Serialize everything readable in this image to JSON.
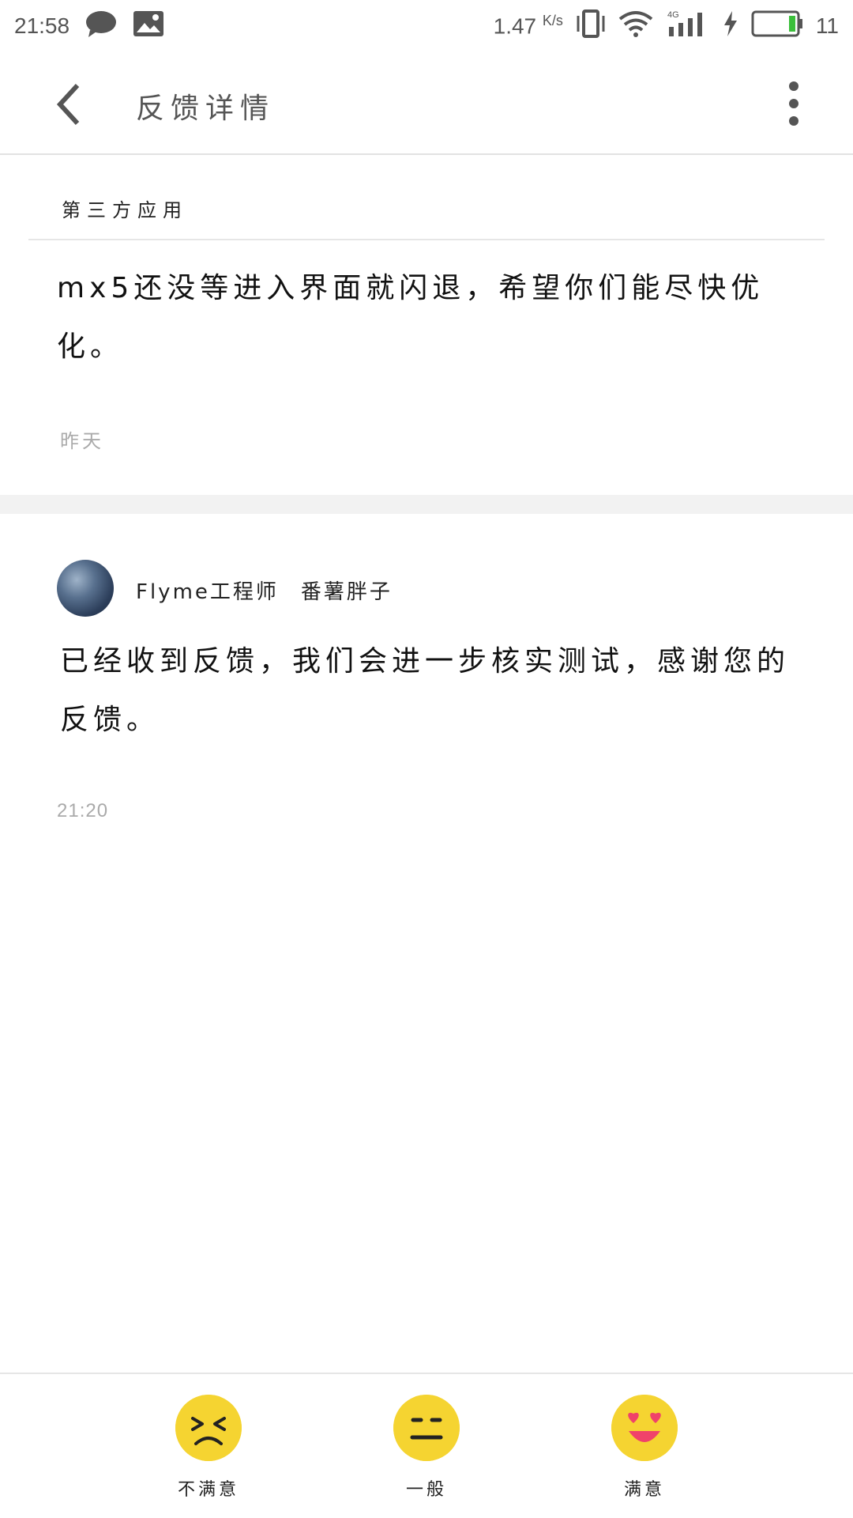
{
  "status_bar": {
    "time": "21:58",
    "network_speed": "1.47",
    "network_speed_unit": "K/s",
    "battery_level": "11",
    "icons": [
      "message-icon",
      "image-icon",
      "vibrate-icon",
      "wifi-icon",
      "signal-4g-icon",
      "charging-icon",
      "battery-icon"
    ]
  },
  "app_bar": {
    "title": "反馈详情",
    "back_icon": "chevron-left-icon",
    "more_icon": "more-vertical-icon"
  },
  "feedback": {
    "category": "第三方应用",
    "message": "mx5还没等进入界面就闪退，希望你们能尽快优化。",
    "time": "昨天"
  },
  "reply": {
    "role": "Flyme工程师",
    "name": "番薯胖子",
    "message": "已经收到反馈，我们会进一步核实测试，感谢您的反馈。",
    "time": "21:20"
  },
  "rating": {
    "options": [
      {
        "label": "不满意",
        "icon": "unsatisfied-face-icon"
      },
      {
        "label": "一般",
        "icon": "neutral-face-icon"
      },
      {
        "label": "满意",
        "icon": "satisfied-face-icon"
      }
    ],
    "colors": {
      "face": "#f5d431",
      "heart": "#f0426a",
      "mouth": "#f0426a"
    }
  }
}
